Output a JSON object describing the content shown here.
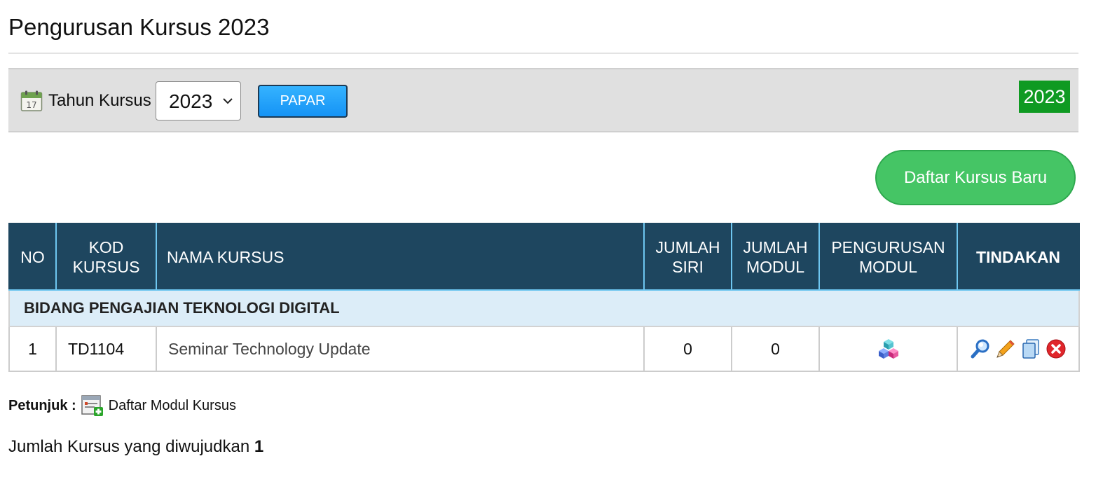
{
  "page": {
    "title": "Pengurusan Kursus 2023"
  },
  "filter": {
    "label": "Tahun Kursus",
    "year_selected": "2023",
    "papar_label": "PAPAR",
    "year_badge": "2023",
    "calendar_icon": "calendar-icon"
  },
  "actions": {
    "new_course_label": "Daftar Kursus Baru"
  },
  "table": {
    "headers": {
      "no": "NO",
      "kod_kursus": "KOD KURSUS",
      "nama_kursus": "NAMA KURSUS",
      "jumlah_siri": "JUMLAH SIRI",
      "jumlah_modul": "JUMLAH MODUL",
      "pengurusan_modul": "PENGURUSAN MODUL",
      "tindakan": "TINDAKAN"
    },
    "group": "BIDANG PENGAJIAN TEKNOLOGI DIGITAL",
    "rows": [
      {
        "no": "1",
        "kod": "TD1104",
        "nama": "Seminar Technology Update",
        "jumlah_siri": "0",
        "jumlah_modul": "0",
        "modul_icon": "cubes-icon",
        "action_icons": [
          "view-icon",
          "edit-icon",
          "copy-icon",
          "delete-icon"
        ]
      }
    ]
  },
  "hint": {
    "label": "Petunjuk :",
    "icon": "add-module-icon",
    "text": "Daftar Modul Kursus"
  },
  "summary": {
    "text": "Jumlah Kursus yang diwujudkan",
    "count": "1"
  },
  "colors": {
    "header_bg": "#1e465f",
    "header_border": "#6ec6f0",
    "group_bg": "#dcedf8",
    "papar_button": "#1593f5",
    "year_badge": "#0f9a22",
    "new_course_button": "#45c565"
  }
}
